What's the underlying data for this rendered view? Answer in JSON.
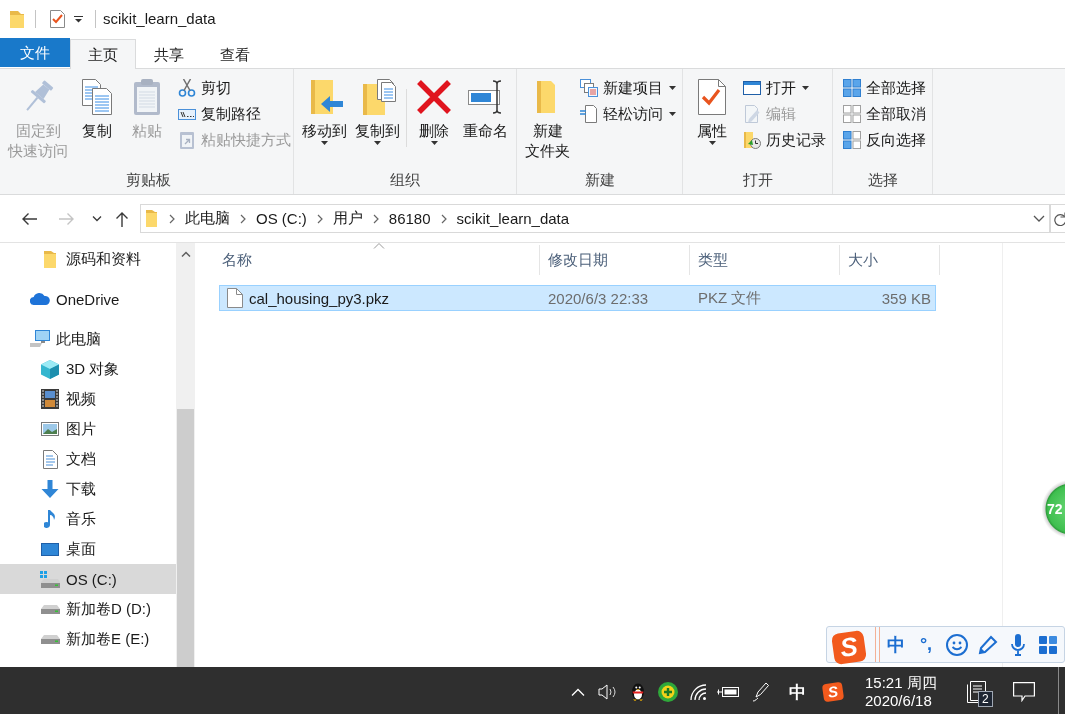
{
  "window": {
    "title": "scikit_learn_data"
  },
  "ribbon_tabs": [
    {
      "label": "文件",
      "kind": "menu",
      "selected": false
    },
    {
      "label": "主页",
      "kind": "tab",
      "selected": true
    },
    {
      "label": "共享",
      "kind": "tab",
      "selected": false
    },
    {
      "label": "查看",
      "kind": "tab",
      "selected": false
    }
  ],
  "ribbon_groups": [
    {
      "label": "剪贴板",
      "clusters": [
        {
          "kind": "large",
          "buttons": [
            {
              "kind": "pin",
              "lines": [
                "固定到",
                "快速访问"
              ],
              "disabled": true,
              "dropdown": false
            },
            {
              "kind": "copy",
              "lines": [
                "复制"
              ],
              "disabled": false,
              "dropdown": false
            },
            {
              "kind": "paste",
              "lines": [
                "粘贴"
              ],
              "disabled": true,
              "dropdown": false
            }
          ]
        },
        {
          "kind": "small",
          "buttons": [
            {
              "kind": "cut",
              "label": "剪切",
              "disabled": false,
              "dropdown": false
            },
            {
              "kind": "copypath",
              "label": "复制路径",
              "disabled": false,
              "dropdown": false
            },
            {
              "kind": "pasteshortcut",
              "label": "粘贴快捷方式",
              "disabled": true,
              "dropdown": false
            }
          ]
        }
      ]
    },
    {
      "label": "组织",
      "clusters": [
        {
          "kind": "large",
          "buttons": [
            {
              "kind": "moveto",
              "lines": [
                "移动到"
              ],
              "disabled": false,
              "dropdown": true
            },
            {
              "kind": "copyto",
              "lines": [
                "复制到"
              ],
              "disabled": false,
              "dropdown": true
            }
          ]
        },
        {
          "kind": "separator"
        },
        {
          "kind": "large",
          "buttons": [
            {
              "kind": "delete",
              "lines": [
                "删除"
              ],
              "disabled": false,
              "dropdown": true
            },
            {
              "kind": "rename",
              "lines": [
                "重命名"
              ],
              "disabled": false,
              "dropdown": false
            }
          ]
        }
      ]
    },
    {
      "label": "新建",
      "clusters": [
        {
          "kind": "large",
          "buttons": [
            {
              "kind": "newfolder",
              "lines": [
                "新建",
                "文件夹"
              ],
              "disabled": false,
              "dropdown": false
            }
          ]
        },
        {
          "kind": "small",
          "buttons": [
            {
              "kind": "newitem",
              "label": "新建项目",
              "disabled": false,
              "dropdown": true
            },
            {
              "kind": "easyaccess",
              "label": "轻松访问",
              "disabled": false,
              "dropdown": true
            }
          ]
        }
      ]
    },
    {
      "label": "打开",
      "clusters": [
        {
          "kind": "large",
          "buttons": [
            {
              "kind": "properties",
              "lines": [
                "属性"
              ],
              "disabled": false,
              "dropdown": true
            }
          ]
        },
        {
          "kind": "small",
          "buttons": [
            {
              "kind": "open",
              "label": "打开",
              "disabled": false,
              "dropdown": true
            },
            {
              "kind": "edit",
              "label": "编辑",
              "disabled": true,
              "dropdown": false
            },
            {
              "kind": "history",
              "label": "历史记录",
              "disabled": false,
              "dropdown": false
            }
          ]
        }
      ]
    },
    {
      "label": "选择",
      "clusters": [
        {
          "kind": "small",
          "buttons": [
            {
              "kind": "selectall",
              "label": "全部选择",
              "disabled": false,
              "dropdown": false
            },
            {
              "kind": "selectnone",
              "label": "全部取消",
              "disabled": false,
              "dropdown": false
            },
            {
              "kind": "invert",
              "label": "反向选择",
              "disabled": false,
              "dropdown": false
            }
          ]
        }
      ]
    }
  ],
  "address_bar": {
    "nav_buttons": [
      {
        "kind": "back",
        "disabled": false
      },
      {
        "kind": "forward",
        "disabled": true
      },
      {
        "kind": "recent",
        "disabled": false
      },
      {
        "kind": "up",
        "disabled": false
      }
    ],
    "breadcrumbs": [
      "此电脑",
      "OS (C:)",
      "用户",
      "86180",
      "scikit_learn_data"
    ]
  },
  "navigation_pane": {
    "items": [
      {
        "children": [
          {
            "label": "源码和资料",
            "kind": "folder",
            "selected": false
          }
        ]
      },
      {
        "label": "OneDrive",
        "kind": "cloud",
        "selected": false
      },
      {
        "label": "此电脑",
        "kind": "computer",
        "selected": false,
        "children": [
          {
            "label": "3D 对象",
            "kind": "cube",
            "selected": false
          },
          {
            "label": "视频",
            "kind": "video",
            "selected": false
          },
          {
            "label": "图片",
            "kind": "pictures",
            "selected": false
          },
          {
            "label": "文档",
            "kind": "documents",
            "selected": false
          },
          {
            "label": "下载",
            "kind": "downloads",
            "selected": false
          },
          {
            "label": "音乐",
            "kind": "music",
            "selected": false
          },
          {
            "label": "桌面",
            "kind": "desktop",
            "selected": false
          },
          {
            "label": "OS (C:)",
            "kind": "systemdrive",
            "selected": true
          },
          {
            "label": "新加卷D (D:)",
            "kind": "drive",
            "selected": false
          },
          {
            "label": "新加卷E (E:)",
            "kind": "drive",
            "selected": false
          }
        ]
      }
    ]
  },
  "file_list": {
    "columns": [
      {
        "label": "名称",
        "sorted": true
      },
      {
        "label": "修改日期",
        "sorted": false
      },
      {
        "label": "类型",
        "sorted": false
      },
      {
        "label": "大小",
        "sorted": false
      }
    ],
    "rows": [
      {
        "name": "cal_housing_py3.pkz",
        "modified": "2020/6/3 22:33",
        "type": "PKZ 文件",
        "size": "359 KB",
        "selected": true
      }
    ]
  },
  "floating_ball": {
    "label": "72"
  },
  "ime_toolbar": {
    "logo": "S",
    "mode": "中",
    "punctuation": "°,"
  },
  "taskbar": {
    "input_mode": "中",
    "ime_logo": "S",
    "clock_time": "15:21 周四",
    "clock_date": "2020/6/18",
    "notification_count": "2"
  }
}
